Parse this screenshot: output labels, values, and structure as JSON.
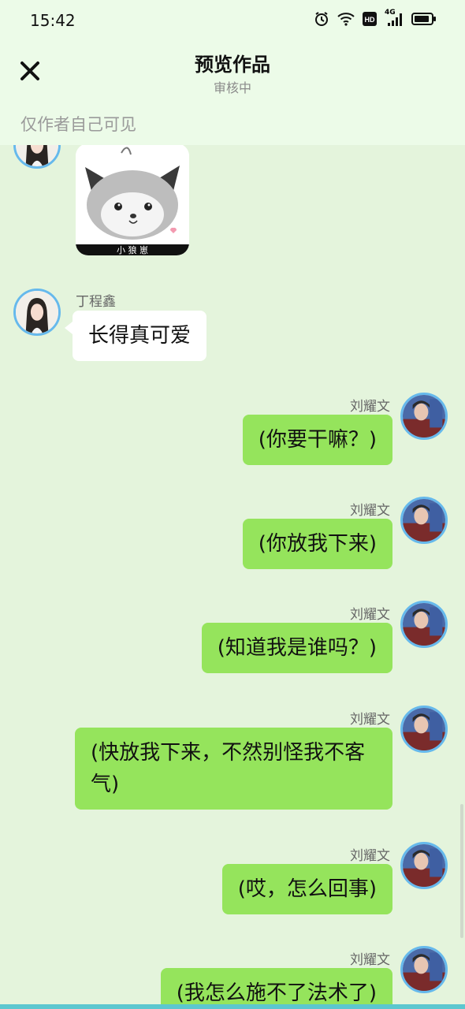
{
  "status_bar": {
    "time": "15:42",
    "network": "4G"
  },
  "header": {
    "title": "预览作品",
    "subtitle": "审核中",
    "visibility_note": "仅作者自己可见"
  },
  "sticker": {
    "caption": "小 狼 崽"
  },
  "messages": [
    {
      "sender": "丁程鑫",
      "side": "left",
      "text": "长得真可爱"
    },
    {
      "sender": "刘耀文",
      "side": "right",
      "text": "(你要干嘛？)"
    },
    {
      "sender": "刘耀文",
      "side": "right",
      "text": "(你放我下来)"
    },
    {
      "sender": "刘耀文",
      "side": "right",
      "text": "(知道我是谁吗？)"
    },
    {
      "sender": "刘耀文",
      "side": "right",
      "text": "(快放我下来，不然别怪我不客气)"
    },
    {
      "sender": "刘耀文",
      "side": "right",
      "text": "(哎，怎么回事)"
    },
    {
      "sender": "刘耀文",
      "side": "right",
      "text": "(我怎么施不了法术了)"
    }
  ],
  "colors": {
    "background": "#e4f4dc",
    "header": "#ecfbe8",
    "bubble_right": "#95e45c",
    "bubble_left": "#ffffff",
    "avatar_ring": "#66b9ec"
  }
}
